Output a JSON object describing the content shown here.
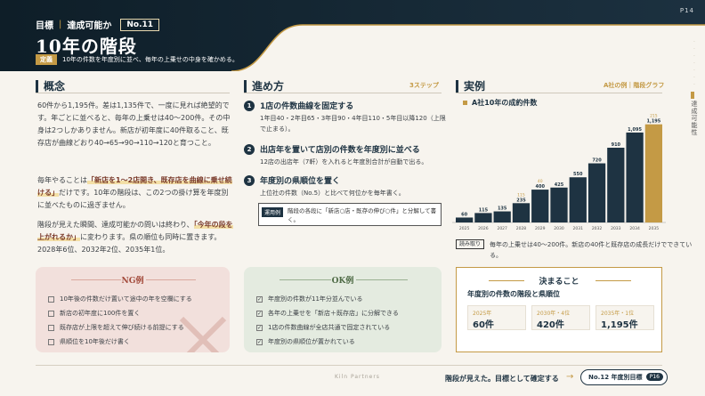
{
  "header": {
    "label": "目標",
    "label2": "達成可能か",
    "no": "No.11",
    "title": "10年の階段",
    "def_tag": "定義",
    "def_text": "10年の件数を年度別に並べ、毎年の上乗せの中身を確かめる。",
    "page": "P14"
  },
  "side": {
    "label": "達成可能性"
  },
  "concept": {
    "heading": "概念",
    "p1": "60件から1,195件。差は1,135件で、一度に見れば絶望的です。年ごとに並べると、毎年の上乗せは40～200件。その中身は2つしかありません。新店が初年度に40件取ること、既存店が曲線どおり40→65→90→110→120と育つこと。",
    "p2a": "毎年やることは",
    "p2hl": "「新店を1～2店開き、既存店を曲線に乗せ続ける」",
    "p2b": "だけです。10年の階段は、この2つの掛け算を年度別に並べたものに過ぎません。",
    "p3a": "階段が見えた瞬間、達成可能かの問いは終わり、",
    "p3hl": "「今年の段を上がれるか」",
    "p3b": "に変わります。県の順位も同時に置きます。2028年6位、2032年2位、2035年1位。"
  },
  "method": {
    "heading": "進め方",
    "sub": "3ステップ",
    "steps": [
      {
        "n": "1",
        "title": "1店の件数曲線を固定する",
        "body": "1年目40・2年目65・3年目90・4年目110・5年目以降120（上限で止まる）。"
      },
      {
        "n": "2",
        "title": "出店年を置いて店別の件数を年度別に並べる",
        "body": "12店の出店年（7軒）を入れると年度別合計が自動で出る。"
      },
      {
        "n": "3",
        "title": "年度別の県順位を置く",
        "body": "上位社の件数（No.5）と比べて何位かを毎年書く。"
      }
    ],
    "note_tag": "運用例",
    "note_text": "階段の各段に「新店○店・既存の伸び○件」と分解して書く。"
  },
  "example": {
    "heading": "実例",
    "sub": "A社の例｜階段グラフ",
    "chart_title": "A社10年の成約件数",
    "reading_tag": "読み取り",
    "reading_text": "毎年の上乗せは40～200件。新店の40件と既存店の成長だけでできている。"
  },
  "chart_data": {
    "type": "bar",
    "categories": [
      "2025",
      "2026",
      "2027",
      "2028",
      "2029",
      "2030",
      "2031",
      "2032",
      "2033",
      "2034",
      "2035"
    ],
    "values": [
      60,
      115,
      135,
      235,
      400,
      425,
      550,
      720,
      910,
      1095,
      1195
    ],
    "labels": [
      "60",
      "115",
      "135",
      "235",
      "400",
      "425",
      "550",
      "720",
      "910",
      "1,095",
      "1,195"
    ],
    "addon_labels": [
      "",
      "",
      "",
      "115",
      "40",
      "",
      "",
      "",
      "",
      "",
      "215"
    ],
    "ylim": [
      0,
      1300
    ],
    "colors": {
      "bar": "#1e3342",
      "highlight": "#c49a45"
    }
  },
  "ng": {
    "title": "NG例",
    "items": [
      "10年後の件数だけ置いて途中の年を空欄にする",
      "新店の初年度に100件を置く",
      "既存店が上限を超えて伸び続ける前提にする",
      "県順位を10年後だけ書く"
    ]
  },
  "ok": {
    "title": "OK例",
    "items": [
      "年度別の件数が11年分並んでいる",
      "各年の上乗せを「新店＋既存店」に分解できる",
      "1店の件数曲線が全店共通で固定されている",
      "年度別の県順位が置かれている"
    ]
  },
  "decide": {
    "title": "決まること",
    "sub": "年度別の件数の階段と県順位",
    "cards": [
      {
        "y": "2025年",
        "v": "60件"
      },
      {
        "y": "2030年・4位",
        "v": "420件"
      },
      {
        "y": "2035年・1位",
        "v": "1,195件"
      }
    ]
  },
  "footer": {
    "brand": "Kiln Partners",
    "text": "階段が見えた。目標として確定する",
    "arrow": "→",
    "next_label": "No.12 年度別目標",
    "next_page": "P16"
  }
}
